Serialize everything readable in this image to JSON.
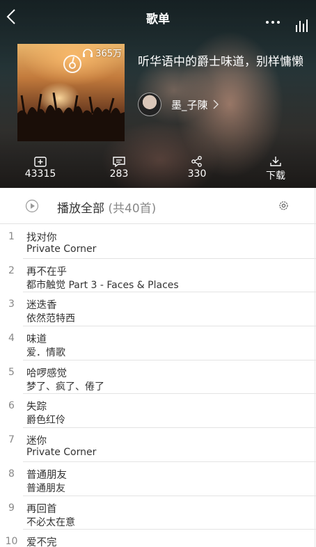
{
  "header": {
    "title": "歌单"
  },
  "playlist": {
    "name": "听华语中的爵士味道，别样慵懒",
    "play_count": "365万",
    "creator": "墨_子陳"
  },
  "actions": {
    "collect": "43315",
    "comments": "283",
    "share": "330",
    "download": "下载"
  },
  "play_all": {
    "label": "播放全部",
    "count": "(共40首)"
  },
  "songs": [
    {
      "index": "1",
      "title": "找对你",
      "album": "Private Corner"
    },
    {
      "index": "2",
      "title": "再不在乎",
      "album": "都市触觉 Part 3 - Faces & Places"
    },
    {
      "index": "3",
      "title": "迷迭香",
      "album": "依然范特西"
    },
    {
      "index": "4",
      "title": "味道",
      "album": "爱．情歌"
    },
    {
      "index": "5",
      "title": "哈啰感觉",
      "album": "梦了、疯了、倦了"
    },
    {
      "index": "6",
      "title": "失踪",
      "album": "爵色红伶"
    },
    {
      "index": "7",
      "title": "迷你",
      "album": "Private Corner"
    },
    {
      "index": "8",
      "title": "普通朋友",
      "album": "普通朋友"
    },
    {
      "index": "9",
      "title": "再回首",
      "album": "不必太在意"
    },
    {
      "index": "10",
      "title": "爱不完",
      "album": ""
    }
  ]
}
